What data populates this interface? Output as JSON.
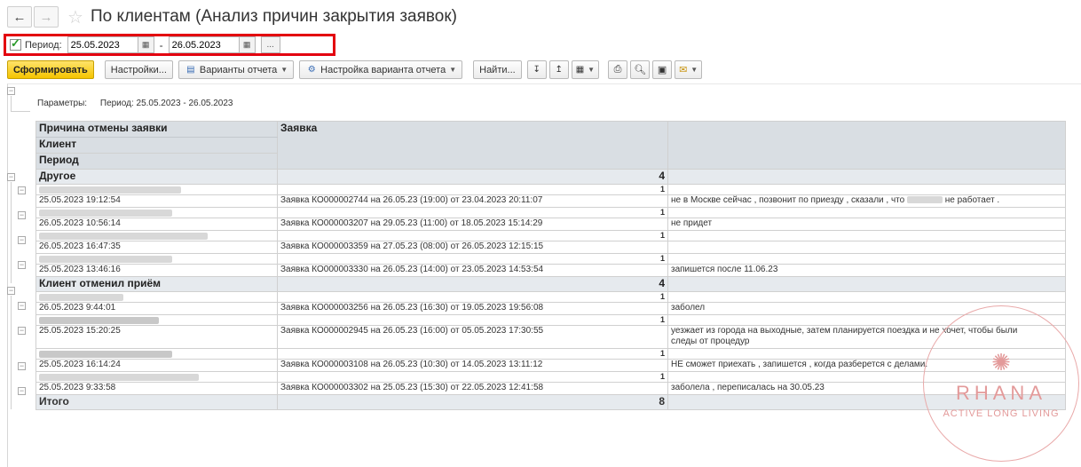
{
  "window": {
    "title": "По клиентам (Анализ причин закрытия заявок)",
    "back_icon": "arrow-left-icon",
    "forward_icon": "arrow-right-icon",
    "favorite_icon": "star-icon"
  },
  "period": {
    "checked": true,
    "label": "Период:",
    "from": "25.05.2023",
    "separator": "-",
    "to": "26.05.2023",
    "more_label": "..."
  },
  "toolbar": {
    "generate": "Сформировать",
    "settings": "Настройки...",
    "variants": "Варианты отчета",
    "variant_settings": "Настройка варианта отчета",
    "find": "Найти..."
  },
  "params": {
    "label": "Параметры:",
    "value": "Период: 25.05.2023 - 26.05.2023"
  },
  "table": {
    "headers": {
      "reason": "Причина отмены заявки",
      "client": "Клиент",
      "period": "Период",
      "request": "Заявка"
    },
    "groups": [
      {
        "name": "Другое",
        "count": "4",
        "rows": [
          {
            "count": "1",
            "date": "25.05.2023 19:12:54",
            "request": "Заявка КО000002744 на 26.05.23 (19:00) от 23.04.2023 20:11:07",
            "comment": "не в Москве  сейчас , позвонит по приезду , сказали , что",
            "comment_tail": "не работает ."
          },
          {
            "count": "1",
            "date": "26.05.2023 10:56:14",
            "request": "Заявка КО000003207 на 29.05.23 (11:00) от 18.05.2023 15:14:29",
            "comment": "не придет",
            "comment_tail": ""
          },
          {
            "count": "1",
            "date": "26.05.2023 16:47:35",
            "request": "Заявка КО000003359 на 27.05.23 (08:00) от 26.05.2023 12:15:15",
            "comment": "",
            "comment_tail": ""
          },
          {
            "count": "1",
            "date": "25.05.2023 13:46:16",
            "request": "Заявка КО000003330 на 26.05.23 (14:00) от 23.05.2023 14:53:54",
            "comment": "запишется после 11.06.23",
            "comment_tail": ""
          }
        ]
      },
      {
        "name": "Клиент отменил приём",
        "count": "4",
        "rows": [
          {
            "count": "1",
            "date": "26.05.2023 9:44:01",
            "request": "Заявка КО000003256 на 26.05.23 (16:30) от 19.05.2023 19:56:08",
            "comment": "заболел",
            "comment_tail": ""
          },
          {
            "count": "1",
            "date": "25.05.2023 15:20:25",
            "request": "Заявка КО000002945 на 26.05.23 (16:00) от 05.05.2023 17:30:55",
            "comment": "уезжает из города на выходные, затем планируется поездка и не хочет, чтобы были",
            "comment_tail": "следы от процедур"
          },
          {
            "count": "1",
            "date": "25.05.2023 16:14:24",
            "request": "Заявка КО000003108 на 26.05.23 (10:30) от 14.05.2023 13:11:12",
            "comment": "НЕ сможет приехать , запишется , когда разберется с делами.",
            "comment_tail": ""
          },
          {
            "count": "1",
            "date": "25.05.2023 9:33:58",
            "request": "Заявка КО000003302 на 25.05.23 (15:30) от 22.05.2023 12:41:58",
            "comment": "заболела , переписалась на 30.05.23",
            "comment_tail": ""
          }
        ]
      }
    ],
    "total_label": "Итого",
    "total_count": "8"
  },
  "watermark": {
    "name": "RHANA",
    "tagline": "ACTIVE LONG LIVING",
    "color": "#e39a9a"
  }
}
